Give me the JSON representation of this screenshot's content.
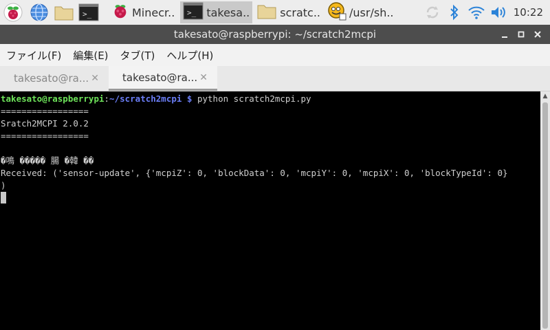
{
  "taskbar": {
    "tasks": [
      {
        "label": "Minecr..",
        "icon": "raspberry-icon"
      },
      {
        "label": "takesa..",
        "icon": "terminal-icon"
      },
      {
        "label": "scratc..",
        "icon": "folder-icon"
      },
      {
        "label": "/usr/sh..",
        "icon": "scratch-cat-icon"
      }
    ],
    "clock": "10:22"
  },
  "window": {
    "title": "takesato@raspberrypi: ~/scratch2mcpi"
  },
  "menu": [
    "ファイル(F)",
    "編集(E)",
    "タブ(T)",
    "ヘルプ(H)"
  ],
  "tabs": [
    {
      "label": "takesato@ra..."
    },
    {
      "label": "takesato@ra..."
    }
  ],
  "terminal": {
    "prompt_user": "takesato@raspberrypi",
    "prompt_sep": ":",
    "prompt_path": "~/scratch2mcpi",
    "prompt_dollar": " $ ",
    "command": "python scratch2mcpi.py",
    "lines": [
      "=================",
      "Sratch2MCPI 2.0.2",
      "=================",
      "",
      "�鳴 ����� 腸 �韓 ��",
      "Received: ('sensor-update', {'mcpiZ': 0, 'blockData': 0, 'mcpiY': 0, 'mcpiX': 0, 'blockTypeId': 0}",
      ")"
    ]
  },
  "colors": {
    "prompt_user": "#6ee45a",
    "prompt_path": "#6b7ef7",
    "titlebar": "#4d4d4d"
  }
}
